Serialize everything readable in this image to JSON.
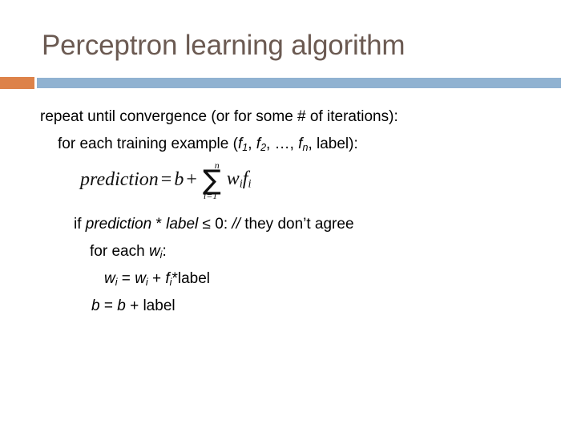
{
  "slide": {
    "title": "Perceptron learning algorithm",
    "title_color": "#6B5A52",
    "accent_orange": "#DD8249",
    "accent_blue": "#90B2D1",
    "body_color": "#000000"
  },
  "body": {
    "line1": "repeat until convergence (or for some # of iterations):",
    "line2_pre": "for each training example (",
    "line2_f": "f",
    "line2_sub1": "1",
    "line2_sep1": ", ",
    "line2_sub2": "2",
    "line2_ellipsis": ", …, ",
    "line2_subn": "n",
    "line2_post": ", label):",
    "line3_if": "if ",
    "line3_prediction": "prediction",
    "line3_star": " * ",
    "line3_label": "label",
    "line3_cond": " ≤ 0:  ",
    "line3_comment_marker": "//",
    "line3_comment": " they don’t agree",
    "line4_pre": "for each ",
    "line4_w": "w",
    "line4_sub": "i",
    "line4_post": ":",
    "line5_w1": "w",
    "line5_sub1": "i",
    "line5_eq": " = ",
    "line5_w2": "w",
    "line5_sub2": "i",
    "line5_plus": " + ",
    "line5_f": "f",
    "line5_sub3": "i",
    "line5_tail": "*label",
    "line6_b1": "b",
    "line6_eq": " = ",
    "line6_b2": "b",
    "line6_tail": " + label"
  },
  "equation": {
    "lhs": "prediction",
    "equals": "=",
    "bias": "b",
    "plus": "+",
    "sigma": "∑",
    "sigma_upper": "n",
    "sigma_lower": "i=1",
    "weight": "w",
    "weight_sub": "i",
    "feature": "f",
    "feature_sub": "i"
  }
}
